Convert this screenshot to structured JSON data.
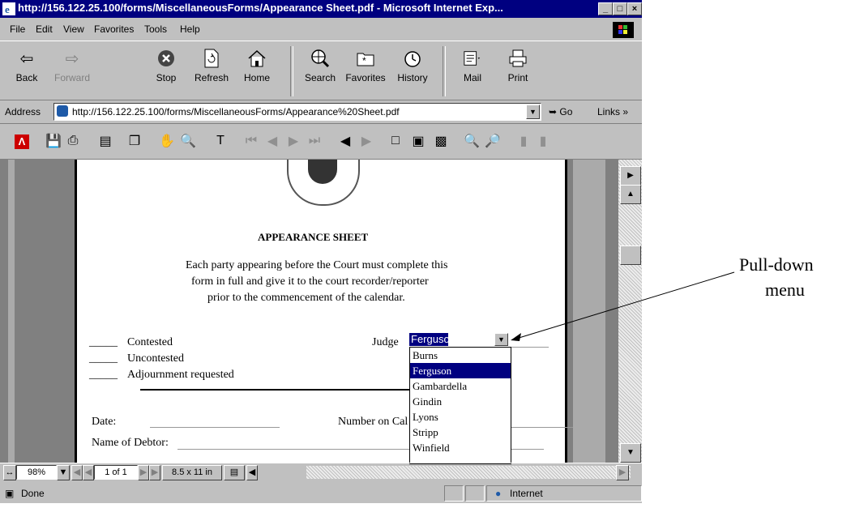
{
  "window": {
    "title": "http://156.122.25.100/forms/MiscellaneousForms/Appearance Sheet.pdf - Microsoft Internet Exp...",
    "min": "_",
    "max": "□",
    "close": "×"
  },
  "menu": [
    "File",
    "Edit",
    "View",
    "Favorites",
    "Tools",
    "Help"
  ],
  "toolbar": {
    "back": "Back",
    "forward": "Forward",
    "stop": "Stop",
    "refresh": "Refresh",
    "home": "Home",
    "search": "Search",
    "favorites": "Favorites",
    "history": "History",
    "mail": "Mail",
    "print": "Print"
  },
  "address": {
    "label": "Address",
    "url": "http://156.122.25.100/forms/MiscellaneousForms/Appearance%20Sheet.pdf",
    "go": "Go",
    "links": "Links »"
  },
  "document": {
    "heading": "APPEARANCE SHEET",
    "instructions": [
      "Each party appearing before the Court must complete this",
      "form in full and give it to the court recorder/reporter",
      "prior to the commencement of the calendar."
    ],
    "blank": "_____",
    "options": [
      "Contested",
      "Uncontested",
      "Adjournment requested"
    ],
    "judge_label": "Judge",
    "judge_value": "Ferguson",
    "judge_options": [
      "Burns",
      "Ferguson",
      "Gambardella",
      "Gindin",
      "Lyons",
      "Stripp",
      "Winfield"
    ],
    "selected_index": 1,
    "date_label": "Date:",
    "number_label": "Number on Cal",
    "debtor_label": "Name of Debtor:"
  },
  "viewer_bar": {
    "zoom": "98%",
    "page": "1 of 1",
    "page_size": "8.5 x 11 in"
  },
  "status": {
    "text": "Done",
    "zone": "Internet"
  },
  "annotation": {
    "line1": "Pull-down",
    "line2": "menu"
  }
}
